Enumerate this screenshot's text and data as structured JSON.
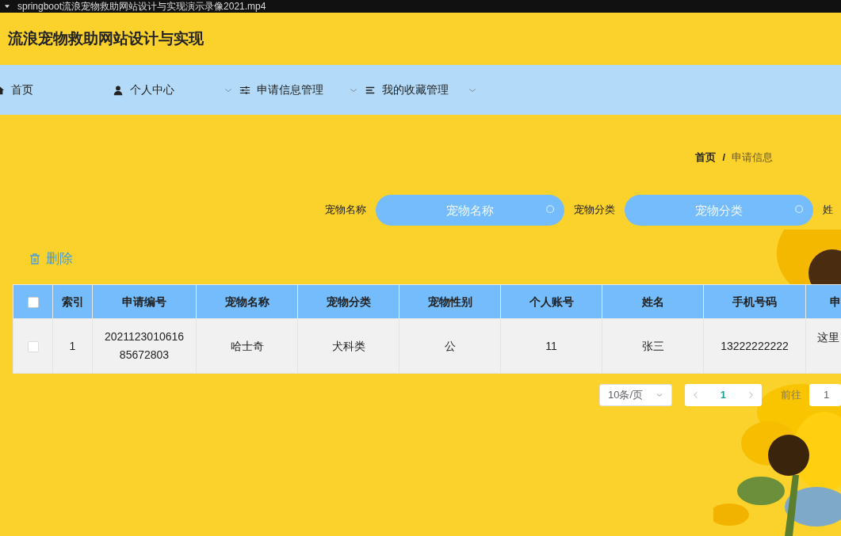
{
  "video_bar": {
    "title": "springboot流浪宠物救助网站设计与实现演示录像2021.mp4"
  },
  "header": {
    "title": "流浪宠物救助网站设计与实现"
  },
  "nav": [
    {
      "label": "首页",
      "kind": "home",
      "dropdown": false
    },
    {
      "label": "个人中心",
      "kind": "user",
      "dropdown": true
    },
    {
      "label": "申请信息管理",
      "kind": "sliders",
      "dropdown": true
    },
    {
      "label": "我的收藏管理",
      "kind": "list",
      "dropdown": true
    }
  ],
  "breadcrumb": {
    "separator": "/",
    "items": [
      "首页",
      "申请信息"
    ]
  },
  "search": [
    {
      "label": "宠物名称",
      "placeholder": "宠物名称"
    },
    {
      "label": "宠物分类",
      "placeholder": "宠物分类"
    },
    {
      "label": "姓"
    }
  ],
  "delete_button": "删除",
  "table": {
    "select_all_checked": false,
    "columns": [
      "索引",
      "申请编号",
      "宠物名称",
      "宠物分类",
      "宠物性别",
      "个人账号",
      "姓名",
      "手机号码",
      "申"
    ],
    "rows": [
      {
        "checked": false,
        "cells": [
          "1",
          "2021123010616\n85672803",
          "哈士奇",
          "犬科类",
          "公",
          "11",
          "张三",
          "13222222222",
          "这里"
        ]
      }
    ]
  },
  "pagination": {
    "page_size": "10条/页",
    "pages": [
      {
        "label": "1",
        "selected": true
      }
    ],
    "goto_label": "前往",
    "goto_value": "1"
  }
}
